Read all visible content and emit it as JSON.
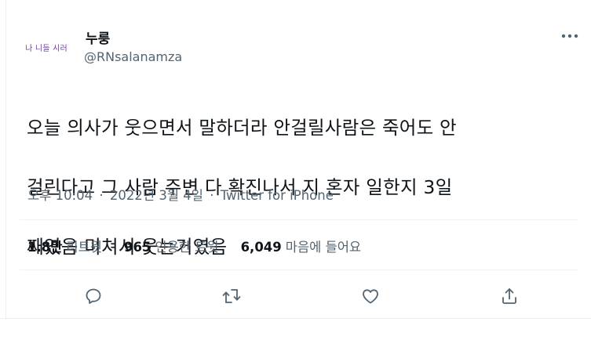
{
  "author": {
    "display_name": "누룽",
    "handle": "@RNsalanamza",
    "avatar_text": "나 니들 시러"
  },
  "tweet": {
    "lines": [
      "오늘 의사가 웃으면서 말하더라 안걸릴사람은 죽어도 안",
      "걸린다고 그 사람 주변 다 확진나서 지 혼자 일한지 3일",
      "째였음 미쳐서 웃는거였음"
    ]
  },
  "meta": {
    "time": "오후 10:04",
    "date": "2022년 3월 4일",
    "source": "Twitter for iPhone",
    "separator": "·"
  },
  "stats": {
    "retweets": {
      "value": "1.8만",
      "label": "리트윗"
    },
    "quotes": {
      "value": "965",
      "label": "인용한 트윗"
    },
    "likes": {
      "value": "6,049",
      "label": "마음에 들어요"
    }
  },
  "icons": {
    "more": "more-horizontal-icon",
    "reply": "reply-icon",
    "retweet": "retweet-icon",
    "like": "heart-icon",
    "share": "share-icon"
  },
  "colors": {
    "text": "#0f1419",
    "secondary": "#536471",
    "divider": "#eff3f4",
    "avatar_text": "#6e3f9a"
  }
}
